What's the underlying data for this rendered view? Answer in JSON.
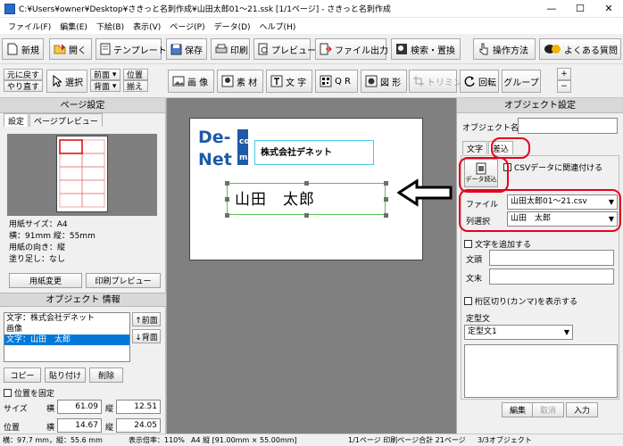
{
  "window": {
    "title": "C:¥Users¥owner¥Desktop¥さきっと名刺作成¥山田太郎01〜21.ssk  [1/1ページ] - さきっと名刺作成",
    "minimize": "—",
    "maximize": "☐",
    "close": "✕"
  },
  "menu": [
    "ファイル(F)",
    "編集(E)",
    "下絵(B)",
    "表示(V)",
    "ページ(P)",
    "データ(D)",
    "ヘルプ(H)"
  ],
  "toolbar1": {
    "new": "新規",
    "open": "開く",
    "template": "テンプレート",
    "save": "保存",
    "print": "印刷",
    "preview": "プレビュー",
    "file_output": "ファイル出力",
    "search_replace": "検索・置換",
    "howto": "操作方法",
    "faq": "よくある質問"
  },
  "toolbar2": {
    "undo": "元に戻す",
    "redo": "やり直す",
    "select": "選択",
    "front": "前面",
    "back": "背面",
    "align1": "位置",
    "align2": "揃え",
    "image": "画 像",
    "material": "素 材",
    "text": "文 字",
    "qr": "Q R",
    "shape": "図 形",
    "trim": "トリミング",
    "rotate": "回転",
    "group": "グループ",
    "zoom_in": "+",
    "zoom_out": "−"
  },
  "page_settings": {
    "header": "ページ設定",
    "tab_settings": "設定",
    "tab_preview": "ページプレビュー",
    "paper_size": "用紙サイズ：A4",
    "dimensions": "横：91mm  縦：55mm",
    "orientation": "用紙の向き：縦",
    "bleed": "塗り足し：なし",
    "change_paper": "用紙変更",
    "print_preview": "印刷プレビュー"
  },
  "object_info": {
    "header": "オブジェクト 情報",
    "items": [
      "文字：株式会社デネット",
      "画像",
      "文字：山田　太郎"
    ],
    "front": "↑前面",
    "back": "↓背面",
    "copy": "コピー",
    "paste": "貼り付け",
    "delete": "削除",
    "lock_position": "位置を固定",
    "size_label": "サイズ",
    "position_label": "位置",
    "horizontal": "横",
    "vertical": "縦",
    "size_w": "61.09",
    "size_h": "12.51",
    "pos_x": "14.67",
    "pos_y": "24.05"
  },
  "card": {
    "logo_top": "De-",
    "logo_bottom": "Net",
    "logo_side_top": "co",
    "logo_side_bottom": "m",
    "company": "株式会社デネット",
    "name": "山田　太郎"
  },
  "object_settings": {
    "header": "オブジェクト設定",
    "object_name_label": "オブジェクト名",
    "object_name_value": "",
    "tab_text": "文字",
    "tab_merge": "差込",
    "data_load": "データ読込",
    "link_csv": "CSVデータに関連付ける",
    "file_label": "ファイル",
    "file_value": "山田太郎01〜21.csv",
    "column_label": "列選択",
    "column_value": "山田　太郎",
    "add_text": "文字を追加する",
    "prefix_label": "文頭",
    "suffix_label": "文末",
    "comma": "桁区切り(カンマ)を表示する",
    "fixed_text_label": "定型文",
    "fixed_text_value": "定型文1",
    "edit": "編集",
    "cancel": "取消",
    "input": "入力"
  },
  "status": {
    "coords": "横：97.7 mm，縦：55.6 mm",
    "zoom": "表示倍率：110%",
    "paper": "A4 縦 [91.00mm × 55.00mm]",
    "pages": "1/1ページ 印刷ページ合計 21ページ",
    "objects": "3/3オブジェクト"
  },
  "colors": {
    "annotation_red": "#e8001c",
    "selection_blue": "#0078d7",
    "logo_blue": "#1e5aa8"
  }
}
